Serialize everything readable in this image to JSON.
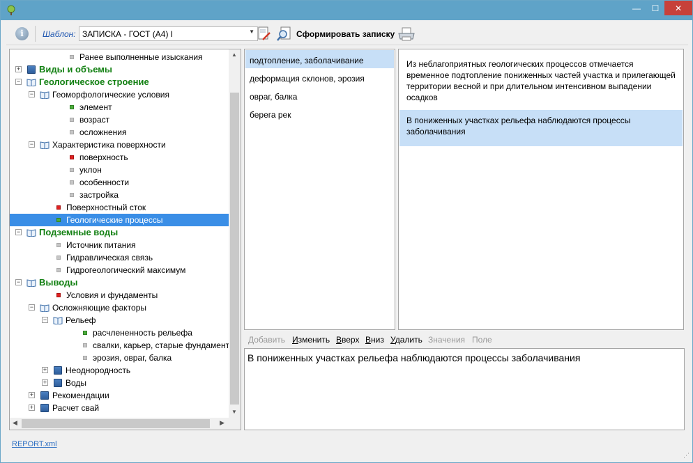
{
  "window": {
    "controls": {
      "minimize": "—",
      "maximize": "☐",
      "close": "✕"
    }
  },
  "toolbar": {
    "info_glyph": "i",
    "template_label": "Шаблон:",
    "template_value": "ЗАПИСКА - ГОСТ (А4) I",
    "make_label": "Сформировать записку",
    "icons": [
      "info-icon",
      "edit-template-icon",
      "preview-icon",
      "printer-icon"
    ]
  },
  "tree": {
    "expand_glyph": "+",
    "collapse_glyph": "−",
    "items": [
      {
        "label": "Ранее выполненные изыскания",
        "level": 2,
        "type": "bullet",
        "color": "grey"
      },
      {
        "label": "Виды и объемы",
        "level": 0,
        "type": "book",
        "expander": "plus",
        "bold": true
      },
      {
        "label": "Геологическое строение",
        "level": 0,
        "type": "open",
        "expander": "minus",
        "bold": true
      },
      {
        "label": "Геоморфологические условия",
        "level": 1,
        "type": "open",
        "expander": "minus"
      },
      {
        "label": "элемент",
        "level": 2,
        "type": "bullet",
        "color": "green"
      },
      {
        "label": "возраст",
        "level": 2,
        "type": "bullet",
        "color": "grey"
      },
      {
        "label": "осложнения",
        "level": 2,
        "type": "bullet",
        "color": "grey"
      },
      {
        "label": "Характеристика поверхности",
        "level": 1,
        "type": "open",
        "expander": "minus"
      },
      {
        "label": "поверхность",
        "level": 2,
        "type": "bullet",
        "color": "red"
      },
      {
        "label": "уклон",
        "level": 2,
        "type": "bullet",
        "color": "grey"
      },
      {
        "label": "особенности",
        "level": 2,
        "type": "bullet",
        "color": "grey"
      },
      {
        "label": "застройка",
        "level": 2,
        "type": "bullet",
        "color": "grey"
      },
      {
        "label": "Поверхностный сток",
        "level": 1,
        "type": "bullet",
        "color": "red"
      },
      {
        "label": "Геологические процессы",
        "level": 1,
        "type": "bullet",
        "color": "green",
        "selected": true
      },
      {
        "label": "Подземные воды",
        "level": 0,
        "type": "open",
        "expander": "minus",
        "bold": true
      },
      {
        "label": "Источник питания",
        "level": 1,
        "type": "bullet",
        "color": "grey"
      },
      {
        "label": "Гидравлическая связь",
        "level": 1,
        "type": "bullet",
        "color": "grey"
      },
      {
        "label": "Гидрогеологический максимум",
        "level": 1,
        "type": "bullet",
        "color": "grey"
      },
      {
        "label": "Выводы",
        "level": 0,
        "type": "open",
        "expander": "minus",
        "bold": true
      },
      {
        "label": "Условия и фундаменты",
        "level": 1,
        "type": "bullet",
        "color": "red"
      },
      {
        "label": "Осложняющие факторы",
        "level": 1,
        "type": "open",
        "expander": "minus"
      },
      {
        "label": "Рельеф",
        "level": 2,
        "type": "open",
        "expander": "minus"
      },
      {
        "label": "расчлененность рельефа",
        "level": 3,
        "type": "bullet",
        "color": "green"
      },
      {
        "label": "свалки, карьер, старые фундаменты",
        "level": 3,
        "type": "bullet",
        "color": "grey"
      },
      {
        "label": "эрозия, овраг, балка",
        "level": 3,
        "type": "bullet",
        "color": "grey"
      },
      {
        "label": "Неоднородность",
        "level": 2,
        "type": "book",
        "expander": "plus"
      },
      {
        "label": "Воды",
        "level": 2,
        "type": "book",
        "expander": "plus"
      },
      {
        "label": "Рекомендации",
        "level": 1,
        "type": "book",
        "expander": "plus"
      },
      {
        "label": "Расчет свай",
        "level": 1,
        "type": "book",
        "expander": "plus"
      }
    ],
    "scroll_up": "▲",
    "scroll_down": "▼",
    "scroll_left": "◀",
    "scroll_right": "▶"
  },
  "processes": [
    {
      "label": "подтопление, заболачивание",
      "selected": true
    },
    {
      "label": "деформация склонов, эрозия"
    },
    {
      "label": "овраг, балка"
    },
    {
      "label": "берега рек"
    }
  ],
  "texts": [
    {
      "text": "Из неблагоприятных геологических процессов отмечается временное подтопление пониженных частей участка и прилегающей территории весной и при длительном интенсивном выпадении осадков"
    },
    {
      "text": "В пониженных участках рельефа наблюдаются процессы заболачивания",
      "selected": true
    }
  ],
  "actions": {
    "add": "Добавить",
    "edit_u": "И",
    "edit_rest": "зменить",
    "up_u": "В",
    "up_rest": "верх",
    "down_u": "В",
    "down_rest": "низ",
    "delete_u": "У",
    "delete_rest": "далить",
    "values": "Значения",
    "field": "Поле"
  },
  "editor": {
    "text": "В пониженных участках рельефа наблюдаются процессы заболачивания"
  },
  "status": {
    "file_link": "REPORT.xml"
  },
  "colors": {
    "titlebar": "#5fa3c8",
    "close_button": "#c7413a",
    "tree_selection": "#3a8ee6",
    "list_selection": "#c7dff7",
    "section_green": "#128012",
    "template_label": "#1f56b0"
  }
}
